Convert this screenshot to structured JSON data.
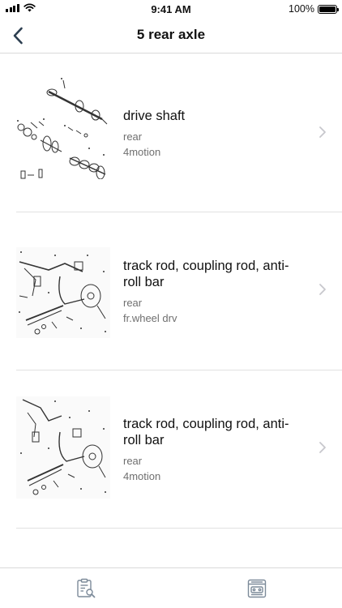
{
  "status": {
    "time": "9:41 AM",
    "battery": "100%",
    "battery_level": 1.0
  },
  "nav": {
    "title": "5 rear axle",
    "back_icon": "chevron-left-icon"
  },
  "items": [
    {
      "title": "drive shaft",
      "lines": [
        "rear",
        "4motion"
      ],
      "thumbnail": "drive-shaft-diagram"
    },
    {
      "title": "track rod, coupling rod, anti-roll bar",
      "lines": [
        "rear",
        "fr.wheel drv"
      ],
      "thumbnail": "suspension-diagram"
    },
    {
      "title": "track rod, coupling rod, anti-roll bar",
      "lines": [
        "rear",
        "4motion"
      ],
      "thumbnail": "suspension-diagram"
    }
  ],
  "tabs": [
    {
      "icon": "clipboard-search-icon"
    },
    {
      "icon": "parts-catalog-icon"
    }
  ],
  "colors": {
    "accent": "#2c3e50",
    "divider": "#e1e1e1",
    "secondary_text": "#6f6f6f",
    "tab_icon": "#7c8a99"
  }
}
